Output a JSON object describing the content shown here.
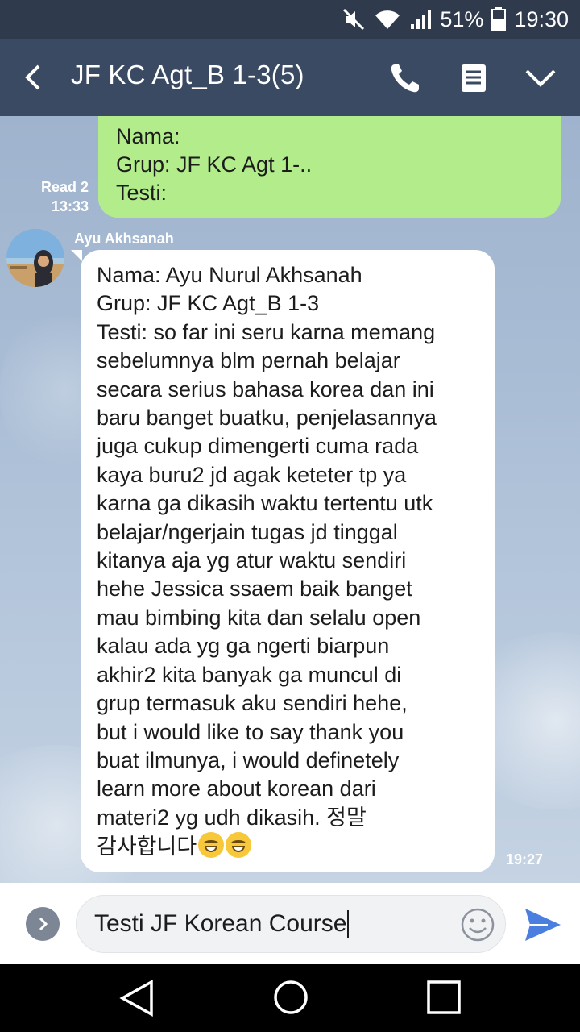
{
  "status_bar": {
    "battery": "51%",
    "time": "19:30",
    "icons": [
      "mute-icon",
      "wifi-icon",
      "signal-icon",
      "battery-icon"
    ]
  },
  "header": {
    "title": "JF KC Agt_B 1-3(5)",
    "icons": [
      "back-arrow-icon",
      "phone-icon",
      "notes-icon",
      "chevron-down-icon"
    ]
  },
  "messages": {
    "outgoing": {
      "lines": [
        "Nama:",
        "Grup: JF KC Agt 1-..",
        "Testi:"
      ],
      "read": "Read 2",
      "time": "13:33"
    },
    "incoming": {
      "sender": "Ayu Akhsanah",
      "lines": [
        "Nama: Ayu Nurul Akhsanah",
        "Grup: JF KC Agt_B 1-3",
        "Testi: so far ini seru karna memang",
        "sebelumnya blm pernah belajar",
        "secara serius bahasa korea dan ini",
        "baru banget buatku, penjelasannya",
        "juga cukup dimengerti cuma rada",
        "kaya buru2 jd agak keteter tp ya",
        "karna ga dikasih waktu tertentu utk",
        "belajar/ngerjain tugas jd tinggal",
        "kitanya aja yg atur waktu sendiri",
        "hehe Jessica ssaem baik banget",
        "mau bimbing kita dan selalu open",
        "kalau ada yg ga ngerti biarpun",
        "akhir2 kita banyak ga muncul di",
        "grup termasuk aku sendiri hehe,",
        "but i would like to say thank you",
        "buat ilmunya, i would definetely",
        "learn more about korean dari",
        "materi2 yg udh dikasih. 정말",
        "감사합니다"
      ],
      "time": "19:27"
    }
  },
  "input": {
    "value": "Testi JF Korean Course"
  },
  "colors": {
    "header_bg": "#3b4a63",
    "status_bg": "#2f3a4c",
    "outgoing_bubble": "#b2ec8b",
    "incoming_bubble": "#ffffff",
    "send_accent": "#4a7fe0"
  }
}
